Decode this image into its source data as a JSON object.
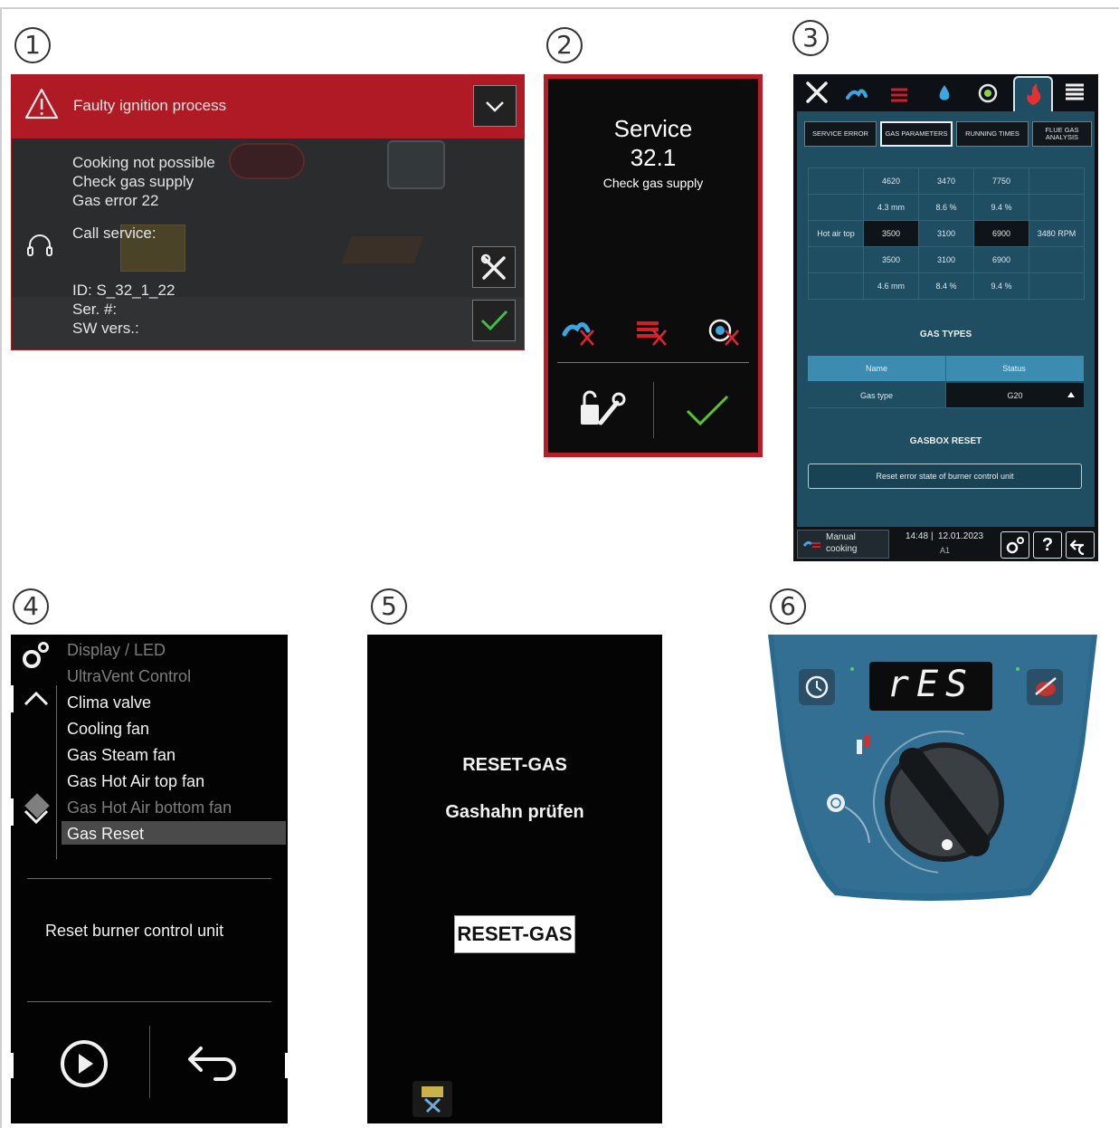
{
  "step_numbers": [
    "1",
    "2",
    "3",
    "4",
    "5",
    "6"
  ],
  "panel1": {
    "title": "Faulty ignition process",
    "messages": [
      "Cooking not possible",
      "Check gas supply",
      "Gas error 22"
    ],
    "call_service": "Call service:",
    "id_line": "ID: S_32_1_22",
    "serial_line": "Ser. #:",
    "sw_line": "SW vers.:",
    "colors": {
      "header": "#b01a25",
      "confirm": "#3fbf46"
    }
  },
  "panel2": {
    "title": "Service",
    "code": "32.1",
    "message": "Check gas supply"
  },
  "panel3": {
    "tabs": [
      "SERVICE ERROR",
      "GAS PARAMETERS",
      "RUNNING TIMES",
      "FLUE GAS ANALYSIS"
    ],
    "table": [
      [
        "",
        "4620",
        "3470",
        "7750",
        ""
      ],
      [
        "",
        "4.3 mm",
        "8.6 %",
        "9.4 %",
        ""
      ],
      [
        "Hot air top",
        "3500",
        "3100",
        "6900",
        "3480 RPM"
      ],
      [
        "",
        "3500",
        "3100",
        "6900",
        ""
      ],
      [
        "",
        "4.6 mm",
        "8.4 %",
        "9.4 %",
        ""
      ]
    ],
    "gas_types_heading": "GAS TYPES",
    "gas_types_columns": [
      "Name",
      "Status"
    ],
    "gas_type_name": "Gas type",
    "gas_type_value": "G20",
    "gasbox_heading": "GASBOX RESET",
    "reset_button": "Reset error state of burner control unit",
    "footer_mode_1": "Manual",
    "footer_mode_2": "cooking",
    "time": "14:48",
    "date": "12.01.2023",
    "footer_sub": "A1",
    "help_label": "?"
  },
  "panel4": {
    "menu": [
      "Display / LED",
      "UltraVent Control",
      "Clima valve",
      "Cooling fan",
      "Gas Steam fan",
      "Gas Hot Air top fan",
      "Gas Hot Air bottom fan",
      "Gas Reset"
    ],
    "description": "Reset burner control unit"
  },
  "panel5": {
    "title": "RESET-GAS",
    "instruction": "Gashahn prüfen",
    "button": "RESET-GAS"
  },
  "panel6": {
    "display": "rES"
  }
}
